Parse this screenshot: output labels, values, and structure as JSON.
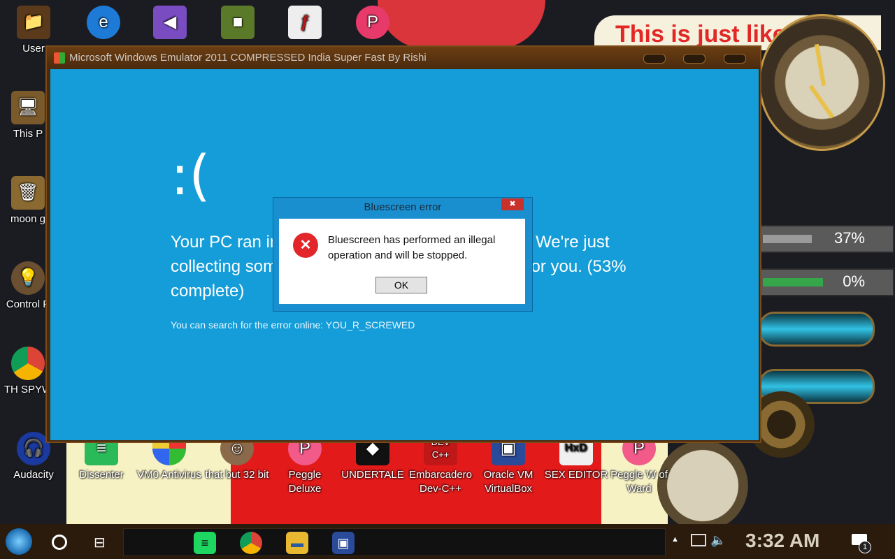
{
  "window": {
    "title": "Microsoft Windows Emulator 2011 COMPRESSED India Super Fast By Rishi"
  },
  "bsod": {
    "face": ":(",
    "message": "Your PC ran into a problem and needs to restart. We're just collecting some error info, and then we'll restart for you. (53% complete)",
    "error_line": "You can search for the error online: YOU_R_SCREWED"
  },
  "dialog": {
    "title": "Bluescreen error",
    "close_label": "✖",
    "message": "Bluescreen has performed an illegal operation and will be stopped.",
    "ok_label": "OK"
  },
  "desktop": {
    "banner_text": "This is just like...",
    "meters": [
      {
        "label": "37%",
        "value": 0.37
      },
      {
        "label": "0%",
        "value": 0.0
      }
    ],
    "icons_left": [
      {
        "label": "User"
      },
      {
        "label": "This P"
      },
      {
        "label": "moon g"
      },
      {
        "label": "Control P"
      },
      {
        "label": "TH SPYW"
      },
      {
        "label": "Audacity"
      }
    ],
    "icons_bottom": [
      {
        "label": "Dissenter"
      },
      {
        "label": "VM0 Antivirus"
      },
      {
        "label": "that but 32 bit"
      },
      {
        "label": "Peggle Deluxe"
      },
      {
        "label": "UNDERTALE"
      },
      {
        "label": "Embarcadero Dev-C++"
      },
      {
        "label": "Oracle VM VirtualBox"
      },
      {
        "label": "SEX EDITOR"
      },
      {
        "label": "Peggle W of Ward"
      }
    ]
  },
  "taskbar": {
    "time": "3:32 AM",
    "notification_count": "1",
    "pinned": [
      "spotify-icon",
      "chrome-icon",
      "file-explorer-icon",
      "virtualbox-icon"
    ]
  },
  "colors": {
    "bsod_blue": "#149dd8",
    "error_red": "#e2262a"
  }
}
